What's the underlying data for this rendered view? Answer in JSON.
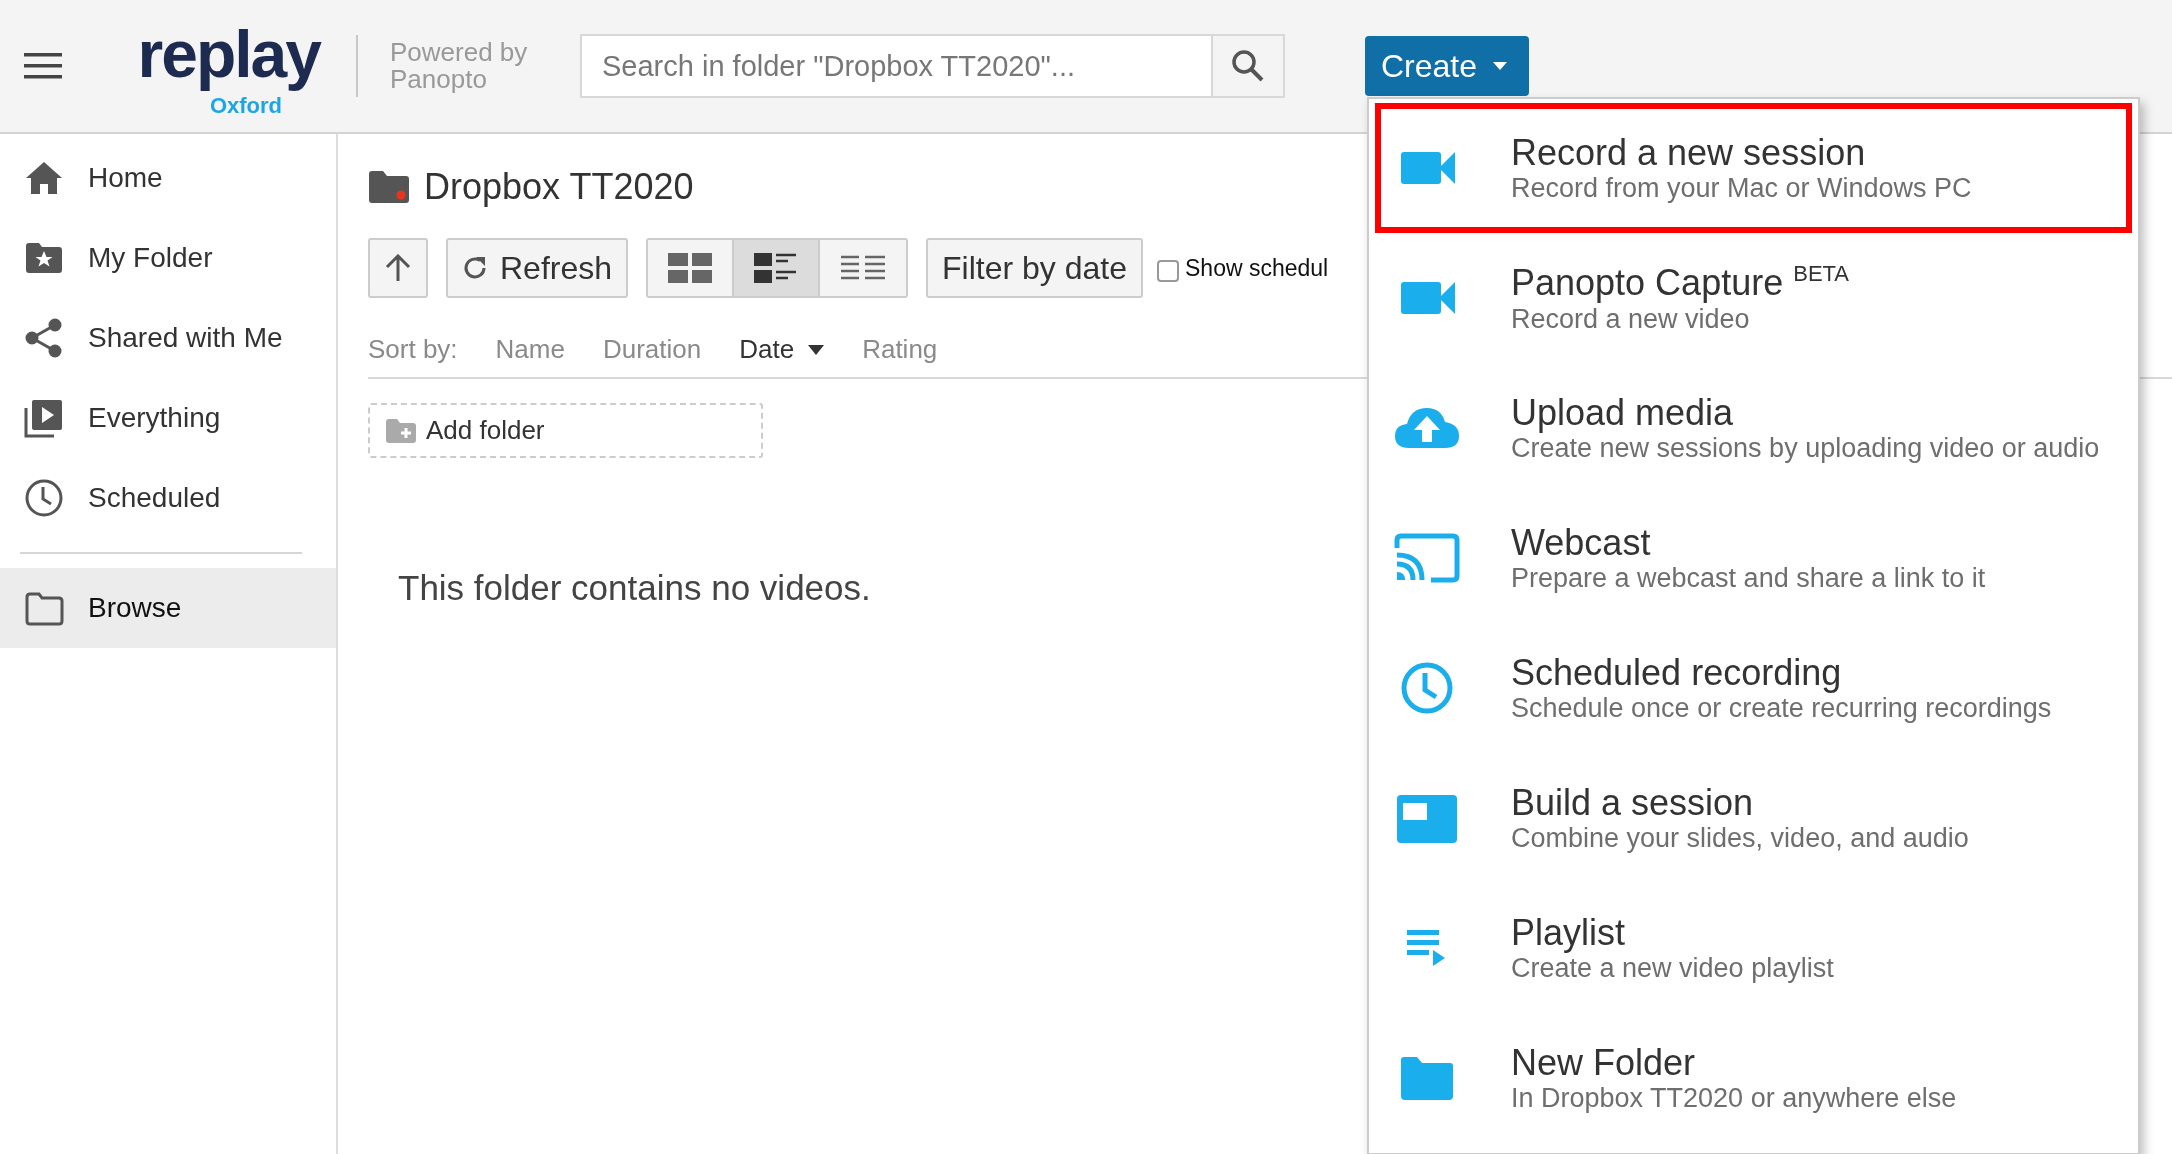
{
  "header": {
    "logo": {
      "word": "replay",
      "sub": "Oxford"
    },
    "powered_by": [
      "Powered by",
      "Panopto"
    ],
    "search": {
      "placeholder": "Search in folder \"Dropbox TT2020\"..."
    },
    "create_button": {
      "label": "Create",
      "expanded": true
    }
  },
  "sidebar": {
    "items": [
      {
        "label": "Home",
        "selected": false
      },
      {
        "label": "My Folder",
        "selected": false
      },
      {
        "label": "Shared with Me",
        "selected": false
      },
      {
        "label": "Everything",
        "selected": false
      },
      {
        "label": "Scheduled",
        "selected": false
      }
    ],
    "browse": {
      "label": "Browse",
      "selected": true
    }
  },
  "folder": {
    "title": "Dropbox TT2020",
    "toolbar": {
      "refresh": "Refresh",
      "views": [
        {
          "selected": false
        },
        {
          "selected": true
        },
        {
          "selected": false
        }
      ],
      "filter": "Filter by date",
      "show_scheduled": {
        "label": "Show schedul",
        "checked": false
      }
    },
    "sort": {
      "label": "Sort by:",
      "options": [
        {
          "label": "Name",
          "selected": false
        },
        {
          "label": "Duration",
          "selected": false
        },
        {
          "label": "Date",
          "selected": true
        },
        {
          "label": "Rating",
          "selected": false
        }
      ]
    },
    "add_folder": "Add folder",
    "empty_message": "This folder contains no videos."
  },
  "create_menu": {
    "items": [
      {
        "title": "Record a new session",
        "subtitle": "Record from your Mac or Windows PC",
        "highlighted": true
      },
      {
        "title": "Panopto Capture $^{BETA}$",
        "subtitle": "Record a new video",
        "highlighted": false
      },
      {
        "title": "Upload media",
        "subtitle": "Create new sessions by uploading video or audio",
        "highlighted": false
      },
      {
        "title": "Webcast",
        "subtitle": "Prepare a webcast and share a link to it",
        "highlighted": false
      },
      {
        "title": "Scheduled recording",
        "subtitle": "Schedule once or create recurring recordings",
        "highlighted": false
      },
      {
        "title": "Build a session",
        "subtitle": "Combine your slides, video, and audio",
        "highlighted": false
      },
      {
        "title": "Playlist",
        "subtitle": "Create a new video playlist",
        "highlighted": false
      },
      {
        "title": "New Folder",
        "subtitle": "In Dropbox TT2020 or anywhere else",
        "highlighted": false
      }
    ]
  }
}
